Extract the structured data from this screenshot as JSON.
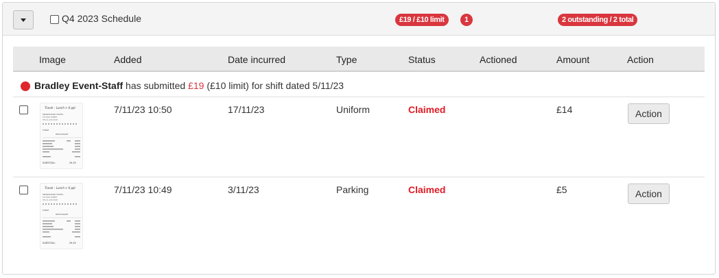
{
  "schedule": {
    "title": "Q4 2023 Schedule",
    "limit_badge": "£19 / £10 limit",
    "count_badge": "1",
    "outstanding_badge": "2 outstanding / 2 total"
  },
  "columns": [
    "Image",
    "Added",
    "Date incurred",
    "Type",
    "Status",
    "Actioned",
    "Amount",
    "Action"
  ],
  "notice": {
    "name": "Bradley Event-Staff",
    "text1": " has submitted ",
    "amount": "£19",
    "text2": " (£10 limit) for shift dated 5/11/23"
  },
  "rows": [
    {
      "added": "7/11/23 10:50",
      "date_incurred": "17/11/23",
      "type": "Uniform",
      "status": "Claimed",
      "actioned": "",
      "amount": "£14",
      "action_label": "Action"
    },
    {
      "added": "7/11/23 10:49",
      "date_incurred": "3/11/23",
      "type": "Parking",
      "status": "Claimed",
      "actioned": "",
      "amount": "£5",
      "action_label": "Action"
    }
  ],
  "receipt": {
    "handwriting": "Travel – Lunch > 6 ppl",
    "hotel": "SMARTLEIGH HOTEL",
    "address1": "55 HIGH STREET",
    "address2": "TEL 01 234 5678",
    "table": "TABLE",
    "section": "RESTAURANT",
    "subtotal_label": "SUBTOTAL:",
    "subtotal_value": "29.25"
  },
  "colors": {
    "badge": "#d9363e",
    "status_claimed": "#e01b24",
    "header_bg": "#f4f4f4",
    "table_head_bg": "#e9e9e9"
  }
}
